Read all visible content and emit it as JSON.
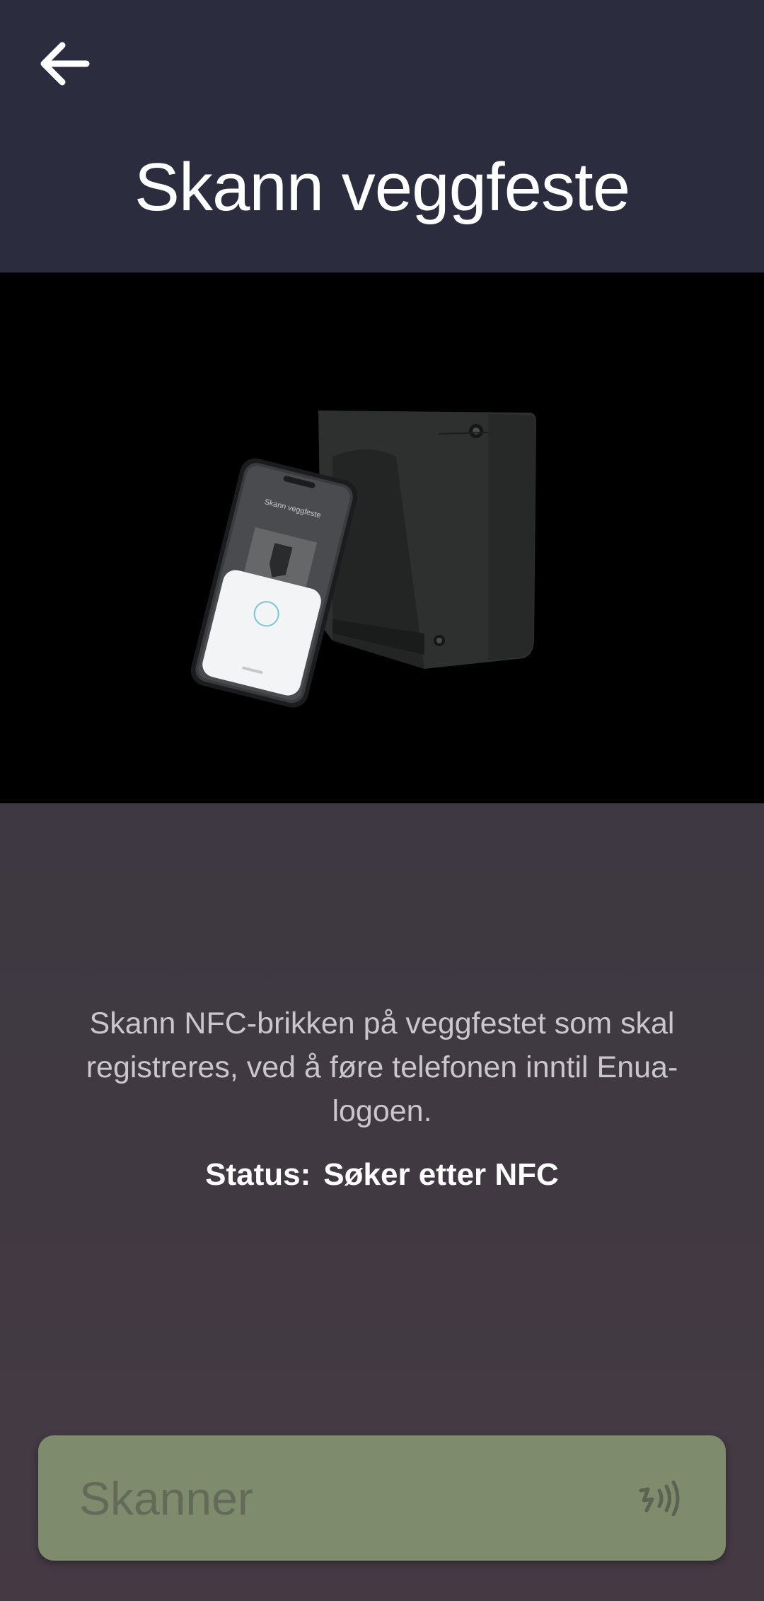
{
  "header": {
    "back_icon": "arrow-left-icon",
    "title": "Skann veggfeste"
  },
  "hero": {
    "device_screen_title": "Skann veggfeste"
  },
  "instructions": {
    "text": "Skann NFC-brikken på veggfestet som skal registreres, ved å føre telefonen inntil Enua-logoen.",
    "status_label": "Status:",
    "status_value": "Søker etter NFC"
  },
  "scan_button": {
    "label": "Skanner",
    "icon": "nfc-icon",
    "color": "#7f8b6d"
  },
  "colors": {
    "header_bg": "#2b2d3e",
    "hero_bg": "#000000"
  }
}
